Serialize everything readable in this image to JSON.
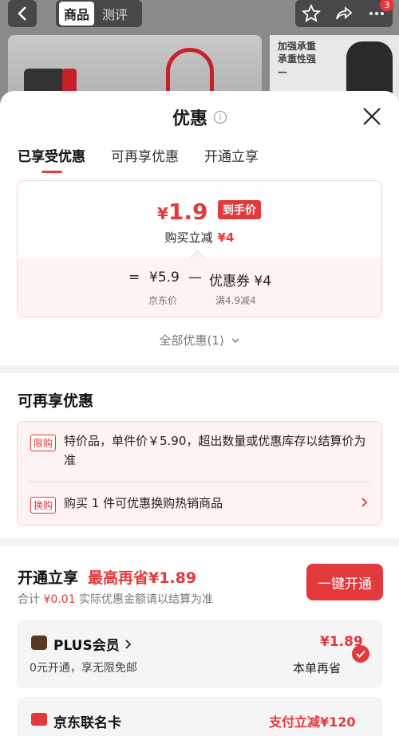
{
  "background": {
    "tabs": [
      "商品",
      "测评"
    ],
    "badge_count": "3",
    "promo_text": "加强承重\n承重性强\n—"
  },
  "sheet": {
    "title": "优惠",
    "tabs": [
      "已享受优惠",
      "可再享优惠",
      "开通立享"
    ],
    "price": {
      "yen": "¥",
      "final_value": "1.9",
      "final_tag": "到手价",
      "discount_label": "购买立减",
      "discount_value": "¥4",
      "equals": "=",
      "jd_price": "¥5.9",
      "minus": "—",
      "coupon": "优惠券 ¥4",
      "jd_price_label": "京东价",
      "coupon_label": "满4.9减4"
    },
    "all_offers": "全部优惠(1)",
    "more_offers": {
      "title": "可再享优惠",
      "items": [
        {
          "tag": "限购",
          "text": "特价品，单件价￥5.90，超出数量或优惠库存以结算价为准"
        },
        {
          "tag": "换购",
          "text": "购买 1 件可优惠换购热销商品"
        }
      ]
    },
    "open": {
      "title": "开通立享",
      "save": "最高再省¥1.89",
      "sub_prefix": "合计",
      "sub_amount": "¥0.01",
      "sub_suffix": "实际优惠金额请以结算为准",
      "button": "一键开通",
      "plus": {
        "name": "PLUS会员",
        "desc": "0元开通，享无限免邮",
        "price": "¥1.89",
        "price_sub": "本单再省"
      },
      "card2": {
        "name": "京东联名卡",
        "promo": "支付立减¥120"
      }
    }
  },
  "colors": {
    "accent": "#e4393c"
  }
}
